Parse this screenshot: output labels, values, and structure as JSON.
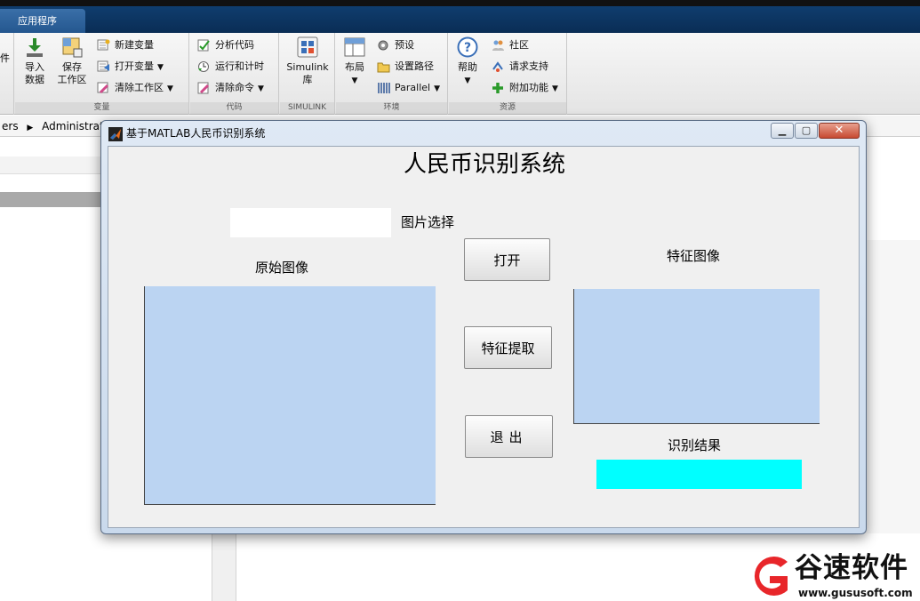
{
  "desktop": {
    "tab_label": "应用程序",
    "ribbon": {
      "partial_left_label": "件",
      "variable_group": {
        "label": "变量",
        "import_label_1": "导入",
        "import_label_2": "数据",
        "save_label_1": "保存",
        "save_label_2": "工作区",
        "new_variable": "新建变量",
        "open_variable": "打开变量",
        "clear_workspace": "清除工作区"
      },
      "code_group": {
        "label": "代码",
        "analyze_code": "分析代码",
        "run_and_time": "运行和计时",
        "clear_commands": "清除命令"
      },
      "simulink_group": {
        "label": "SIMULINK",
        "simulink_label_1": "Simulink",
        "simulink_label_2": "库"
      },
      "environment_group": {
        "label": "环境",
        "layout_label": "布局",
        "preferences": "预设",
        "set_path": "设置路径",
        "parallel": "Parallel"
      },
      "resources_group": {
        "label": "资源",
        "help_label": "帮助",
        "community": "社区",
        "request_support": "请求支持",
        "addons": "附加功能"
      }
    },
    "address_bar": {
      "path_start": "ers",
      "path_segment": "Administrato"
    }
  },
  "figure": {
    "window_title": "基于MATLAB人民币识别系统",
    "gui_title": "人民币识别系统",
    "path_input_value": "",
    "select_image_label": "图片选择",
    "original_image_label": "原始图像",
    "open_button": "打开",
    "feature_extract_button": "特征提取",
    "exit_button": "退出",
    "feature_image_label": "特征图像",
    "result_label": "识别结果",
    "result_value": "",
    "colors": {
      "axes_bg": "#bbd4f2",
      "result_bg": "#00ffff",
      "client_bg": "#f0f0f0"
    }
  },
  "watermark": {
    "text": "谷速软件",
    "url": "www.gususoft.com"
  }
}
